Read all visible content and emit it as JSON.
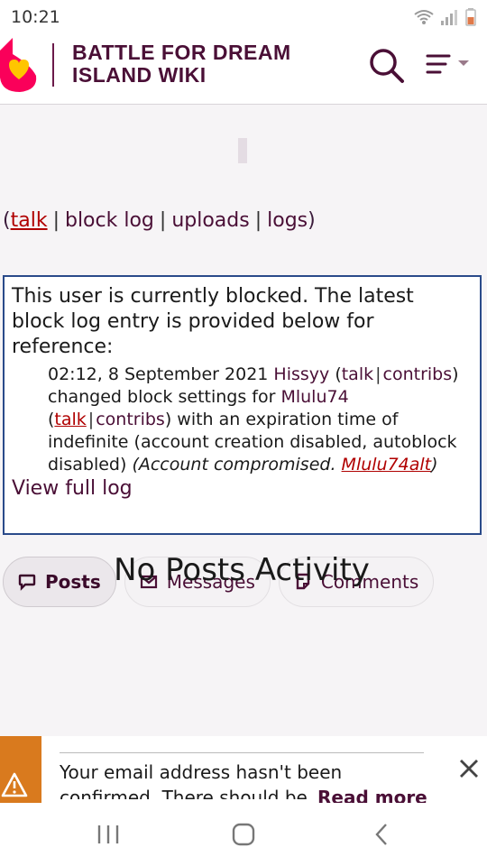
{
  "status": {
    "time": "10:21"
  },
  "header": {
    "title": "Battle for Dream Island Wiki"
  },
  "user_links": {
    "open": "(",
    "talk": "talk",
    "block_log": "block log",
    "uploads": "uploads",
    "logs": "logs",
    "close": ")"
  },
  "block_notice": {
    "intro": "This user is currently blocked. The latest block log entry is provided below for reference:",
    "timestamp": "02:12, 8 September 2021",
    "admin": "Hissyy",
    "admin_talk": "talk",
    "admin_contribs": "contribs",
    "action": "changed block settings for",
    "target": "Mlulu74",
    "target_talk": "talk",
    "target_contribs": "contribs",
    "details": "with an expiration time of indefinite (account creation disabled, autoblock disabled)",
    "reason": "Account compromised.",
    "reason_link": "Mlulu74alt",
    "view_full_log": "View full log"
  },
  "tabs": [
    {
      "label": "Posts",
      "active": true
    },
    {
      "label": "Messages",
      "active": false
    },
    {
      "label": "Comments",
      "active": false
    }
  ],
  "empty_state": "No Posts Activity",
  "banner": {
    "text": "Your email address hasn't been confirmed. There should be",
    "read_more": "Read more"
  },
  "colors": {
    "brand": "#4a0f36",
    "link_red": "#b00000",
    "warning": "#d97a1e",
    "block_border": "#2a4a8a"
  }
}
